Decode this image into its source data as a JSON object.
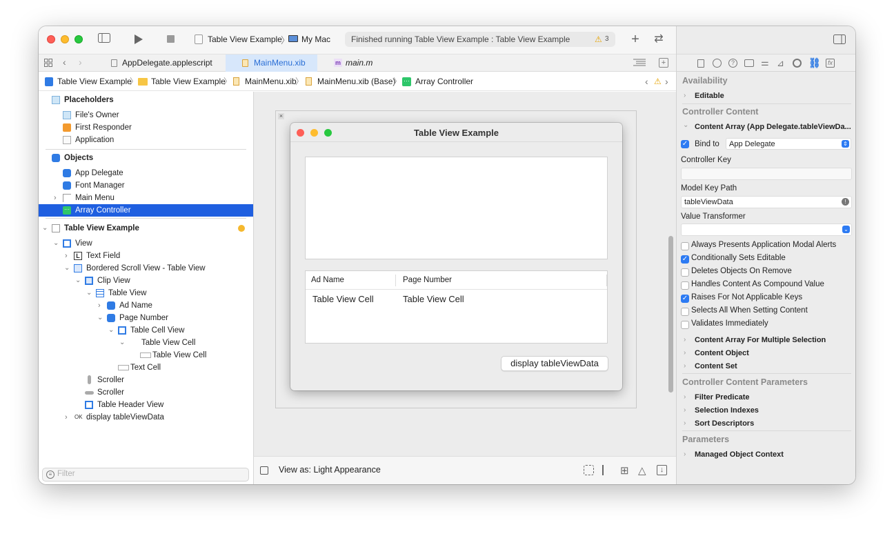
{
  "toolbar": {
    "scheme": "Table View Example",
    "destination": "My Mac",
    "status": "Finished running Table View Example : Table View Example",
    "warning_count": "3"
  },
  "tabs": [
    {
      "label": "AppDelegate.applescript",
      "active": false
    },
    {
      "label": "MainMenu.xib",
      "active": true
    },
    {
      "label": "main.m",
      "active": false
    }
  ],
  "jumpbar": [
    "Table View Example",
    "Table View Example",
    "MainMenu.xib",
    "MainMenu.xib (Base)",
    "Array Controller"
  ],
  "navigator": {
    "placeholders_header": "Placeholders",
    "placeholders": [
      "File's Owner",
      "First Responder",
      "Application"
    ],
    "objects_header": "Objects",
    "objects": [
      "App Delegate",
      "Font Manager",
      "Main Menu",
      "Array Controller"
    ],
    "window_item": "Table View Example",
    "tree": [
      "View",
      "Text Field",
      "Bordered Scroll View - Table View",
      "Clip View",
      "Table View",
      "Ad Name",
      "Page Number",
      "Table Cell View",
      "Table View Cell",
      "Table View Cell",
      "Text Cell",
      "Scroller",
      "Scroller",
      "Table Header View",
      "display tableViewData"
    ],
    "filter_placeholder": "Filter"
  },
  "canvas": {
    "window_title": "Table View Example",
    "col1": "Ad Name",
    "col2": "Page Number",
    "cell1": "Table View Cell",
    "cell2": "Table View Cell",
    "button": "display tableViewData"
  },
  "bottombar": {
    "view_as": "View as: Light Appearance"
  },
  "inspector": {
    "availability": "Availability",
    "editable": "Editable",
    "controller_content": "Controller Content",
    "content_array": "Content Array (App Delegate.tableViewDa...",
    "bind_to_label": "Bind to",
    "bind_to_value": "App Delegate",
    "controller_key_label": "Controller Key",
    "model_key_path_label": "Model Key Path",
    "model_key_path_value": "tableViewData",
    "value_transformer_label": "Value Transformer",
    "checks": [
      {
        "label": "Always Presents Application Modal Alerts",
        "checked": false
      },
      {
        "label": "Conditionally Sets Editable",
        "checked": true
      },
      {
        "label": "Deletes Objects On Remove",
        "checked": false
      },
      {
        "label": "Handles Content As Compound Value",
        "checked": false
      },
      {
        "label": "Raises For Not Applicable Keys",
        "checked": true
      },
      {
        "label": "Selects All When Setting Content",
        "checked": false
      },
      {
        "label": "Validates Immediately",
        "checked": false
      }
    ],
    "more": [
      "Content Array For Multiple Selection",
      "Content Object",
      "Content Set"
    ],
    "ccp_header": "Controller Content Parameters",
    "ccp": [
      "Filter Predicate",
      "Selection Indexes",
      "Sort Descriptors"
    ],
    "params_header": "Parameters",
    "params": [
      "Managed Object Context"
    ]
  }
}
